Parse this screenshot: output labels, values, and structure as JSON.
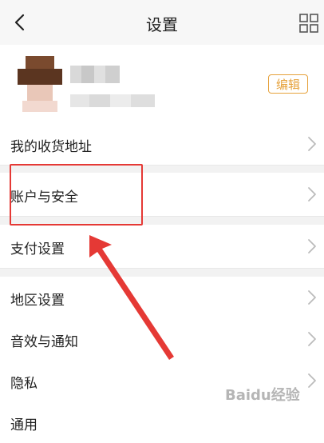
{
  "header": {
    "title": "设置",
    "back_icon": "chevron-left-icon",
    "grid_icon": "grid-icon"
  },
  "profile": {
    "edit_label": "编辑"
  },
  "menu": [
    {
      "label": "我的收货地址"
    },
    {
      "label": "账户与安全"
    },
    {
      "label": "支付设置"
    },
    {
      "label": "地区设置"
    },
    {
      "label": "音效与通知"
    },
    {
      "label": "隐私"
    },
    {
      "label": "通用"
    }
  ],
  "annotation": {
    "color": "#e53935"
  },
  "watermark": "Baidu经验"
}
